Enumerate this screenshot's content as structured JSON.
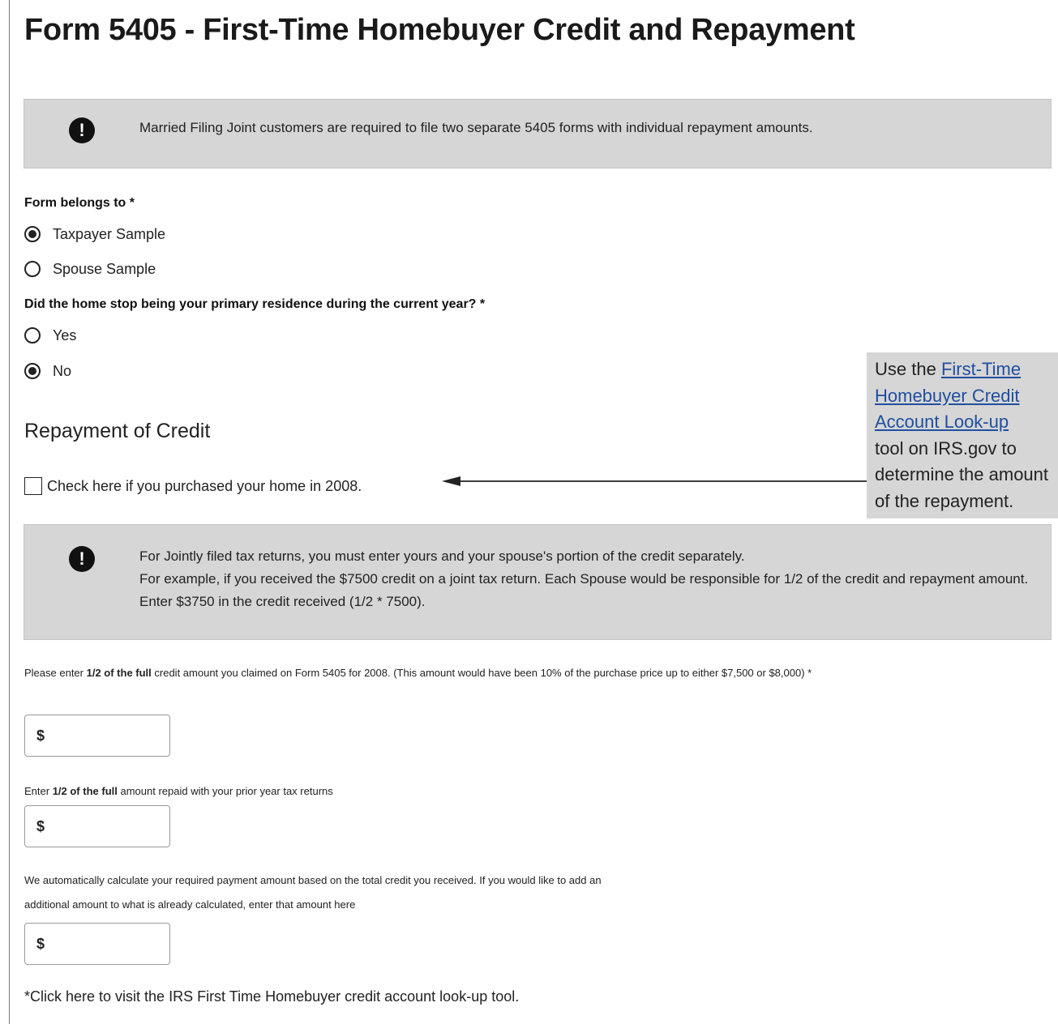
{
  "page": {
    "title": "Form 5405 - First-Time Homebuyer Credit and Repayment"
  },
  "alert1": {
    "icon": "exclamation-icon",
    "text": "Married Filing Joint customers are required to file two separate 5405 forms with individual repayment amounts."
  },
  "form_belongs_to": {
    "label": "Form belongs to *",
    "options": [
      {
        "label": "Taxpayer Sample",
        "checked": true
      },
      {
        "label": "Spouse Sample",
        "checked": false
      }
    ]
  },
  "primary_residence": {
    "label": "Did the home stop being your primary residence during the current year? *",
    "options": [
      {
        "label": "Yes",
        "checked": false
      },
      {
        "label": "No",
        "checked": true
      }
    ]
  },
  "repayment": {
    "title": "Repayment of Credit",
    "checkbox_label": "Check here if you purchased your home in 2008.",
    "checkbox_checked": false
  },
  "callout": {
    "prefix": "Use the ",
    "link_lines": [
      "First-Time",
      "Homebuyer Credit",
      "Account Look-up"
    ],
    "lines": [
      "tool on IRS.gov to",
      "determine the amount",
      "of the repayment."
    ]
  },
  "alert2": {
    "icon": "exclamation-icon",
    "line1": "For Jointly filed tax returns, you must enter yours and your spouse's portion of the credit separately.",
    "line2": "For example, if you received the $7500 credit on a joint tax return. Each Spouse would be responsible for 1/2 of the credit and repayment amount. Enter $3750 in the credit received (1/2 * 7500)."
  },
  "fields": {
    "credit_claimed": {
      "label_pre": "Please enter ",
      "label_bold": "1/2 of the full",
      "label_post": " credit amount you claimed on Form 5405 for 2008. (This amount would have been 10% of the purchase price up to either $7,500 or $8,000) *",
      "prefix": "$",
      "value": ""
    },
    "amount_repaid": {
      "label_pre": "Enter ",
      "label_bold": "1/2 of the full",
      "label_post": " amount repaid with your prior year tax returns",
      "prefix": "$",
      "value": ""
    },
    "additional_amount": {
      "label_line1": "We automatically calculate your required payment amount based on the total credit you received. If you would like to add an",
      "label_line2": "additional amount to what is already calculated, enter that amount here",
      "prefix": "$",
      "value": ""
    }
  },
  "footer": {
    "link_text": "*Click here to visit the IRS First Time Homebuyer credit account look-up tool."
  }
}
